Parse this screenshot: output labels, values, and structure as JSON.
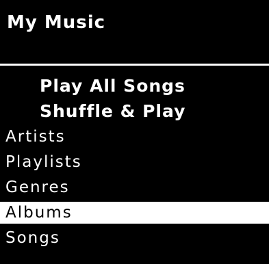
{
  "header": {
    "title": "My Music"
  },
  "menu": {
    "selected_index": 6,
    "items": [
      {
        "label": "Play All Songs"
      },
      {
        "label": "Shuffle & Play"
      },
      {
        "label": "Artists"
      },
      {
        "label": "Playlists"
      },
      {
        "label": "Genres"
      },
      {
        "label": "Albums"
      },
      {
        "label": "Songs"
      }
    ]
  },
  "colors": {
    "background": "#000000",
    "text": "#ffffff",
    "selection_background": "#ffffff",
    "selection_text": "#000000"
  }
}
